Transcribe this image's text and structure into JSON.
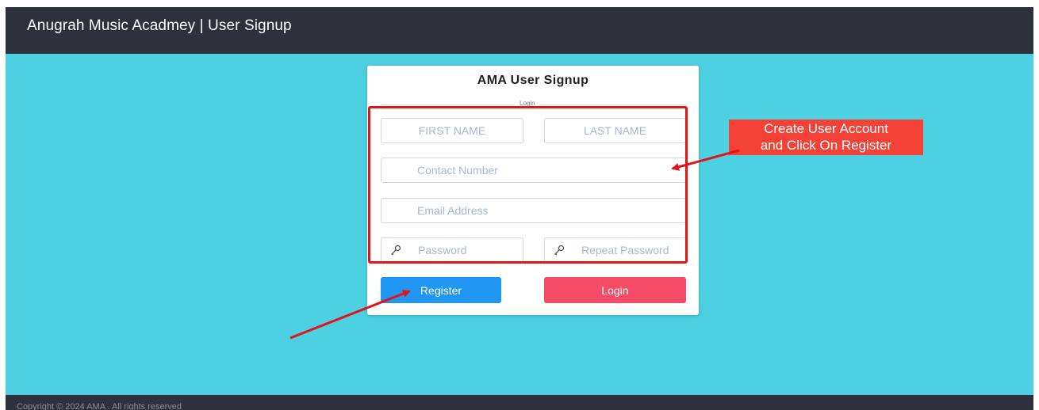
{
  "navbar": {
    "brand": "Anugrah Music Acadmey | User Signup"
  },
  "card": {
    "title": "AMA User Signup",
    "legend": "Login",
    "fields": {
      "first_name": {
        "placeholder": "FIRST NAME",
        "value": ""
      },
      "last_name": {
        "placeholder": "LAST NAME",
        "value": ""
      },
      "contact": {
        "placeholder": "Contact Number",
        "value": ""
      },
      "email": {
        "placeholder": "Email Address",
        "value": ""
      },
      "password": {
        "placeholder": "Password",
        "value": "",
        "icon": "key-icon"
      },
      "repeat_password": {
        "placeholder": "Repeat Password",
        "value": "",
        "icon": "key-icon"
      }
    },
    "buttons": {
      "register": "Register",
      "login": "Login"
    }
  },
  "annotation": {
    "line1": "Create User Account",
    "line2": "and Click On Register"
  },
  "footer": {
    "copyright": "Copyright © 2024 AMA . All rights reserved"
  },
  "colors": {
    "navbar": "#2e313c",
    "background": "#4dd0e1",
    "register": "#2196f3",
    "login": "#f54b64",
    "annotation": "#f44336",
    "highlight": "#e01515"
  }
}
